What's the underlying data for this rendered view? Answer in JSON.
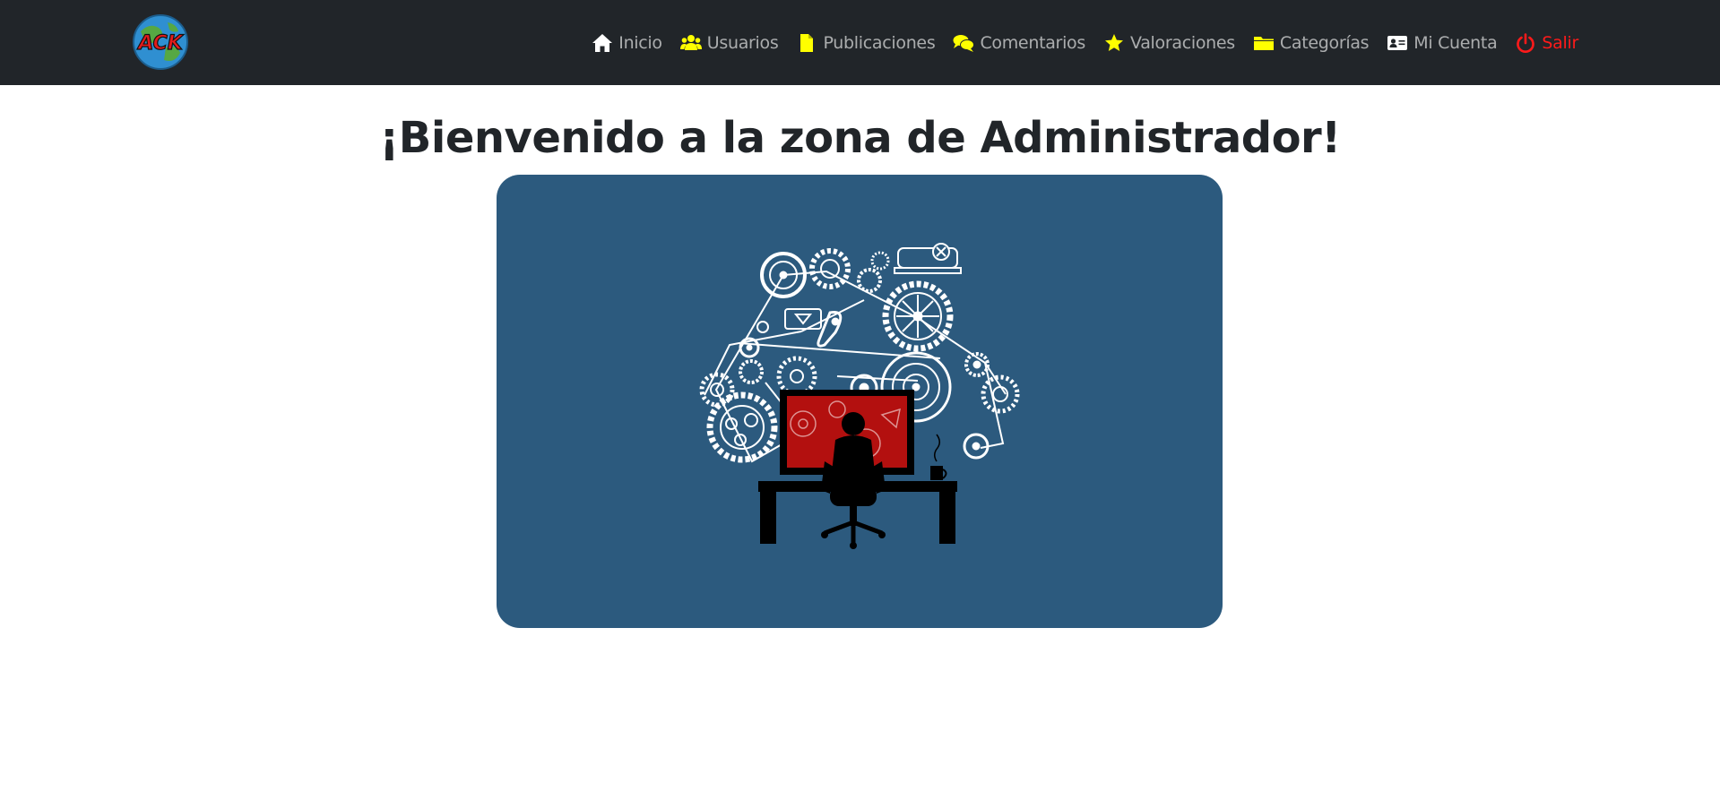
{
  "navbar": {
    "logo_text": "ACK",
    "items": [
      {
        "label": "Inicio",
        "icon": "home-icon",
        "color": "#ffffff"
      },
      {
        "label": "Usuarios",
        "icon": "users-icon",
        "color": "#ffff00"
      },
      {
        "label": "Publicaciones",
        "icon": "file-icon",
        "color": "#ffff00"
      },
      {
        "label": "Comentarios",
        "icon": "comments-icon",
        "color": "#ffff00"
      },
      {
        "label": "Valoraciones",
        "icon": "star-icon",
        "color": "#ffff00"
      },
      {
        "label": "Categorías",
        "icon": "folder-icon",
        "color": "#ffff00"
      },
      {
        "label": "Mi Cuenta",
        "icon": "id-card-icon",
        "color": "#ffffff"
      },
      {
        "label": "Salir",
        "icon": "power-icon",
        "color": "#ff1a1a"
      }
    ]
  },
  "main": {
    "title": "¡Bienvenido a la zona de Administrador!"
  },
  "colors": {
    "navbar_bg": "#212529",
    "card_bg": "#2c5a7e",
    "accent_yellow": "#ffff00",
    "danger": "#ff1a1a"
  }
}
